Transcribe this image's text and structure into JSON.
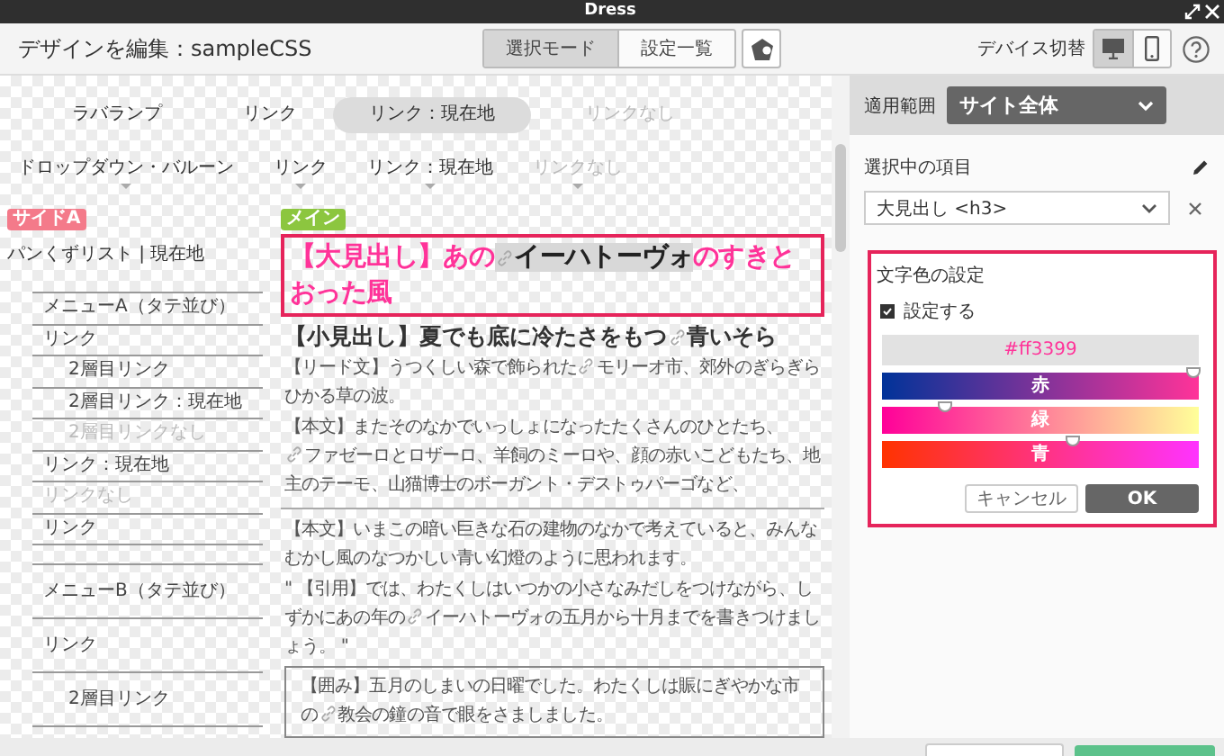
{
  "window": {
    "title": "Dress"
  },
  "toolbar": {
    "title": "デザインを編集：sampleCSS",
    "modes": [
      {
        "label": "選択モード",
        "selected": true
      },
      {
        "label": "設定一覧",
        "selected": false
      }
    ],
    "device_label": "デバイス切替",
    "devices": [
      {
        "kind": "desktop",
        "selected": true
      },
      {
        "kind": "phone",
        "selected": false
      }
    ]
  },
  "canvas": {
    "nav_bar": [
      {
        "label": "ラバランプ",
        "selected": false,
        "disabled": false
      },
      {
        "label": "リンク",
        "selected": false,
        "disabled": false
      },
      {
        "label": "リンク：現在地",
        "selected": true,
        "disabled": false
      },
      {
        "label": "リンクなし",
        "selected": false,
        "disabled": true
      }
    ],
    "dropdown_nav": [
      {
        "label": "ドロップダウン・バルーン",
        "disabled": false
      },
      {
        "label": "リンク",
        "disabled": false
      },
      {
        "label": "リンク：現在地",
        "disabled": false
      },
      {
        "label": "リンクなし",
        "disabled": true
      }
    ],
    "sidebar": {
      "badge": "サイドA",
      "breadcrumb": "パンくずリスト | 現在地",
      "menus": [
        {
          "title": "メニューA（タテ並び）",
          "items": [
            {
              "label": "リンク",
              "disabled": false,
              "children": [
                {
                  "label": "2層目リンク",
                  "disabled": false
                },
                {
                  "label": "2層目リンク：現在地",
                  "disabled": false
                },
                {
                  "label": "2層目リンクなし",
                  "disabled": true
                }
              ]
            },
            {
              "label": "リンク：現在地",
              "disabled": false
            },
            {
              "label": "リンクなし",
              "disabled": true
            },
            {
              "label": "リンク",
              "disabled": false
            }
          ]
        },
        {
          "title": "メニューB（タテ並び）",
          "items": [
            {
              "label": "リンク",
              "disabled": false,
              "children": [
                {
                  "label": "2層目リンク",
                  "disabled": false
                }
              ]
            }
          ]
        }
      ]
    },
    "main": {
      "badge": "メイン",
      "heading": [
        {
          "kind": "text",
          "text": "【大見出し】あの"
        },
        {
          "kind": "link",
          "text": "イーハトーヴォ"
        },
        {
          "kind": "text",
          "text": "のすきとおった風"
        }
      ],
      "subheading": [
        {
          "kind": "text",
          "text": "【小見出し】夏でも底に冷たさをもつ"
        },
        {
          "kind": "link",
          "text": "青いそら"
        }
      ],
      "blocks": [
        {
          "kind": "paragraph",
          "parts": [
            {
              "kind": "text",
              "text": "【リード文】うつくしい森で飾られた"
            },
            {
              "kind": "link",
              "text": "モリーオ市"
            },
            {
              "kind": "text",
              "text": "、郊外のぎらぎらひかる草の波。"
            }
          ]
        },
        {
          "kind": "paragraph",
          "parts": [
            {
              "kind": "text",
              "text": "【本文】またそのなかでいっしょになったたくさんのひとたち、"
            },
            {
              "kind": "link",
              "text": "ファゼーロ"
            },
            {
              "kind": "text",
              "text": "とロザーロ、羊飼のミーロや、顔の赤いこどもたち、地主のテーモ、山猫博士のボーガント・デストゥパーゴなど、"
            }
          ]
        },
        {
          "kind": "rule"
        },
        {
          "kind": "paragraph",
          "parts": [
            {
              "kind": "text",
              "text": "【本文】いまこの暗い巨きな石の建物のなかで考えていると、みんなむかし風のなつかしい青い幻燈のように思われます。"
            }
          ]
        },
        {
          "kind": "quote",
          "parts": [
            {
              "kind": "text",
              "text": "\" 【引用】では、わたくしはいつかの小さなみだしをつけながら、しずかにあの年の"
            },
            {
              "kind": "link",
              "text": "イーハトーヴォ"
            },
            {
              "kind": "text",
              "text": "の五月から十月までを書きつけましょう。 \""
            }
          ]
        },
        {
          "kind": "boxed",
          "parts": [
            {
              "kind": "text",
              "text": "【囲み】五月のしまいの日曜でした。わたくしは賑にぎやかな市の"
            },
            {
              "kind": "link",
              "text": "教会"
            },
            {
              "kind": "text",
              "text": "の鐘の音で眼をさましました。"
            }
          ]
        }
      ]
    }
  },
  "panel": {
    "scope_label": "適用範囲",
    "scope_value": "サイト全体",
    "selected_label": "選択中の項目",
    "selected_item": "大見出し <h3>",
    "color": {
      "title": "文字色の設定",
      "enabled_label": "設定する",
      "checked": true,
      "value": "#ff3399",
      "channels": [
        {
          "name": "赤",
          "level": 1.0
        },
        {
          "name": "緑",
          "level": 0.2
        },
        {
          "name": "青",
          "level": 0.6
        }
      ],
      "buttons": [
        {
          "label": "キャンセル",
          "kind": "secondary"
        },
        {
          "label": "OK",
          "kind": "primary"
        }
      ]
    }
  }
}
